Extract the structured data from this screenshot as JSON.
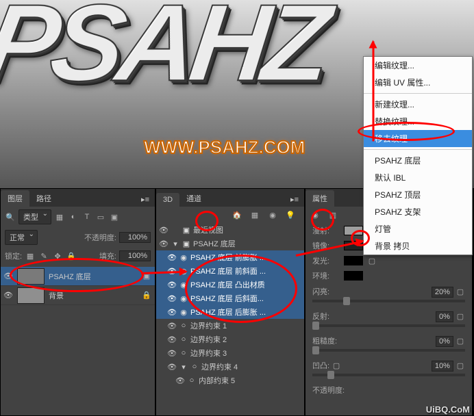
{
  "canvas": {
    "text3d": "PSAHZ",
    "watermark": "WWW.PSAHZ.COM",
    "watermark2": "UiBQ.CoM"
  },
  "layers_panel": {
    "tab_layer": "图层",
    "tab_path": "路径",
    "kind_filter": "类型",
    "blend_mode": "正常",
    "opacity_label": "不透明度:",
    "opacity_value": "100%",
    "lock_label": "锁定:",
    "fill_label": "填充:",
    "fill_value": "100%",
    "items": [
      {
        "name": "PSAHZ 底层"
      },
      {
        "name": "背景"
      }
    ]
  },
  "panel_3d": {
    "tab_3d": "3D",
    "tab_channels": "通道",
    "recent_view": "最近视图",
    "root": "PSAHZ 底层",
    "children": [
      "PSAHZ 底层 前膨胀 ...",
      "PSAHZ 底层 前斜面 ...",
      "PSAHZ 底层 凸出材质",
      "PSAHZ 底层 后斜面...",
      "PSAHZ 底层 后膨胀 ..."
    ],
    "bounds": [
      "边界约束 1",
      "边界约束 2",
      "边界约束 3",
      "边界约束 4"
    ],
    "inner": "内部约束 5"
  },
  "props_panel": {
    "tab": "属性",
    "diffuse": "漫射:",
    "specular": "镜像:",
    "glow": "发光:",
    "ambient": "环境:",
    "shine_label": "闪亮:",
    "shine_value": "20%",
    "reflect_label": "反射:",
    "reflect_value": "0%",
    "rough_label": "粗糙度:",
    "rough_value": "0%",
    "bump_label": "凹凸:",
    "bump_value": "10%",
    "opacity_label": "不透明度:"
  },
  "ctx_menu": {
    "items": [
      {
        "label": "编辑纹理..."
      },
      {
        "label": "编辑 UV 属性..."
      },
      {
        "sep": true
      },
      {
        "label": "新建纹理..."
      },
      {
        "label": "替换纹理..."
      },
      {
        "label": "移去纹理",
        "hover": true
      },
      {
        "sep": true
      },
      {
        "label": "PSAHZ 底层"
      },
      {
        "label": "默认 IBL"
      },
      {
        "label": "PSAHZ 顶层"
      },
      {
        "label": "PSAHZ 支架"
      },
      {
        "label": "灯管"
      },
      {
        "label": "背景 拷贝"
      }
    ]
  }
}
